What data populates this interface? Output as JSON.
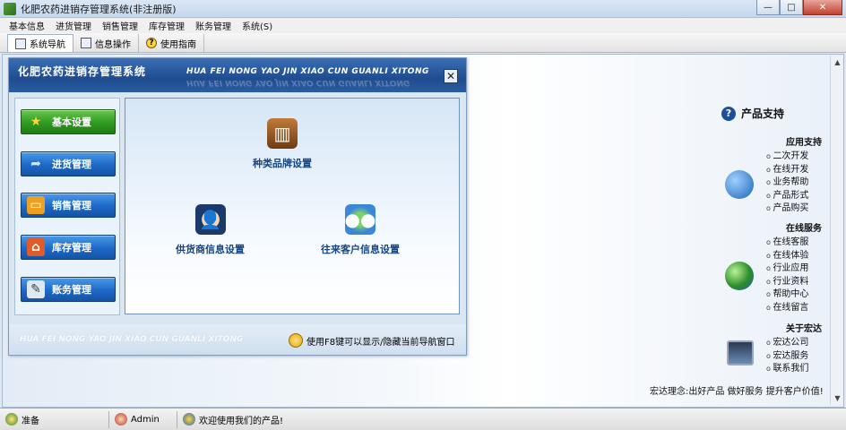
{
  "window": {
    "title": "化肥农药进销存管理系统(非注册版)",
    "buttons": {
      "minimize": "—",
      "maximize": "□",
      "close": "✕"
    }
  },
  "menu": [
    "基本信息",
    "进货管理",
    "销售管理",
    "库存管理",
    "账务管理",
    "系统(S)"
  ],
  "tabs": [
    {
      "label": "系统导航",
      "active": true
    },
    {
      "label": "信息操作"
    },
    {
      "label": "使用指南"
    }
  ],
  "nav": {
    "title": "化肥农药进销存管理系统",
    "pinyin": "HUA FEI NONG YAO JIN XIAO CUN GUANLI XITONG",
    "close_label": "✕",
    "buttons": [
      "基本设置",
      "进货管理",
      "销售管理",
      "库存管理",
      "账务管理"
    ],
    "features": {
      "category_brand": "种类品牌设置",
      "supplier": "供货商信息设置",
      "customer": "往来客户信息设置"
    },
    "footer_pinyin": "HUA FEI NONG YAO JIN XIAO CUN  GUANLI XITONG",
    "footer_hint": "使用F8键可以显示/隐藏当前导航窗口"
  },
  "support": {
    "title": "产品支持",
    "app_support": {
      "title": "应用支持",
      "items": [
        "二次开发",
        "在线开发",
        "业务帮助",
        "产品形式",
        "产品购买"
      ]
    },
    "online_service": {
      "title": "在线服务",
      "items": [
        "在线客服",
        "在线体验",
        "行业应用",
        "行业资料",
        "帮助中心",
        "在线留言"
      ]
    },
    "about": {
      "title": "关于宏达",
      "items": [
        "宏达公司",
        "宏达服务",
        "联系我们"
      ]
    },
    "mission": "宏达理念:出好产品  做好服务  提升客户价值!"
  },
  "status": {
    "ready": "准备",
    "user": "Admin",
    "welcome": "欢迎使用我们的产品!"
  },
  "colors": {
    "green_button": "#2f9a20",
    "blue_header": "#1f4c8f",
    "feature_text": "#18457f"
  }
}
